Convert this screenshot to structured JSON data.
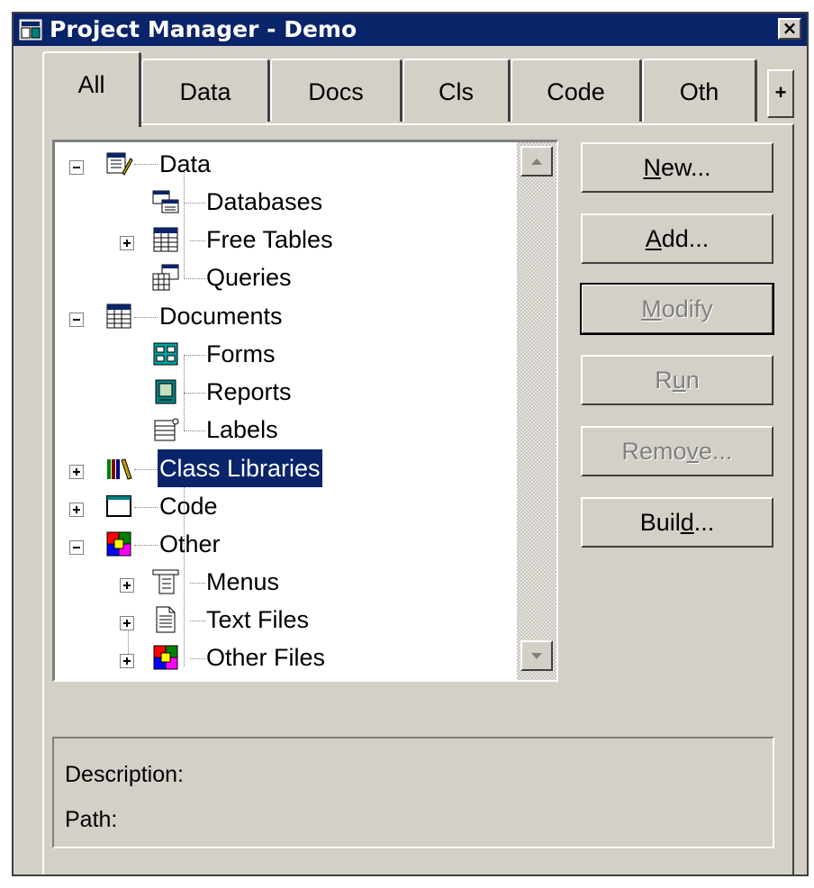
{
  "window": {
    "title": "Project Manager - Demo",
    "close_glyph": "×"
  },
  "tabs": [
    {
      "label": "All",
      "active": true
    },
    {
      "label": "Data",
      "active": false
    },
    {
      "label": "Docs",
      "active": false
    },
    {
      "label": "Cls",
      "active": false
    },
    {
      "label": "Code",
      "active": false
    },
    {
      "label": "Oth",
      "active": false
    }
  ],
  "tab_scroll_glyph": "+",
  "tree": {
    "items": [
      {
        "label": "Data",
        "icon": "data-icon",
        "expander": "minus"
      },
      {
        "label": "Databases",
        "icon": "databases-icon"
      },
      {
        "label": "Free Tables",
        "icon": "free-tables-icon",
        "expander": "plus"
      },
      {
        "label": "Queries",
        "icon": "queries-icon"
      },
      {
        "label": "Documents",
        "icon": "documents-icon",
        "expander": "minus"
      },
      {
        "label": "Forms",
        "icon": "forms-icon"
      },
      {
        "label": "Reports",
        "icon": "reports-icon"
      },
      {
        "label": "Labels",
        "icon": "labels-icon"
      },
      {
        "label": "Class Libraries",
        "icon": "class-libraries-icon",
        "expander": "plus",
        "selected": true
      },
      {
        "label": "Code",
        "icon": "code-icon",
        "expander": "plus"
      },
      {
        "label": "Other",
        "icon": "other-icon",
        "expander": "minus"
      },
      {
        "label": "Menus",
        "icon": "menus-icon",
        "expander": "plus"
      },
      {
        "label": "Text Files",
        "icon": "text-files-icon",
        "expander": "plus"
      },
      {
        "label": "Other Files",
        "icon": "other-files-icon",
        "expander": "plus"
      }
    ]
  },
  "buttons": {
    "new": {
      "pre": "",
      "key": "N",
      "post": "ew...",
      "enabled": true
    },
    "add": {
      "pre": "",
      "key": "A",
      "post": "dd...",
      "enabled": true
    },
    "modify": {
      "pre": "",
      "key": "M",
      "post": "odify",
      "enabled": false
    },
    "run": {
      "pre": "R",
      "key": "u",
      "post": "n",
      "enabled": false
    },
    "remove": {
      "pre": "Remo",
      "key": "v",
      "post": "e...",
      "enabled": false
    },
    "build": {
      "pre": "Buil",
      "key": "d",
      "post": "...",
      "enabled": true
    }
  },
  "info": {
    "description_label": "Description:",
    "path_label": "Path:"
  },
  "colors": {
    "face": "#d4d0c8",
    "title_bar": "#0a246a",
    "selection": "#0a246a"
  }
}
